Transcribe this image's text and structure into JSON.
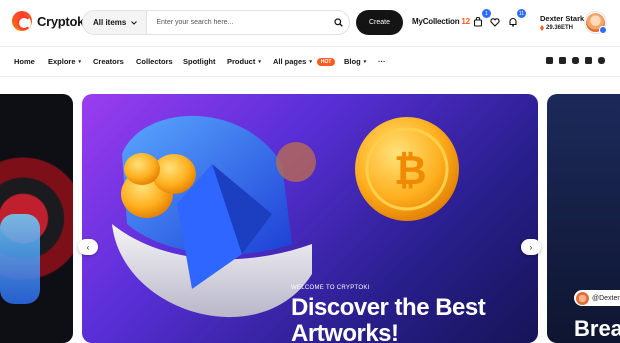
{
  "header": {
    "logo_text": "Cryptoki",
    "search_category": "All items",
    "search_placeholder": "Enter your search here...",
    "create_label": "Create",
    "collection_label": "MyCollection",
    "collection_count": "12",
    "cart_badge": "1",
    "notif_badge": "11",
    "user_name": "Dexter Stark",
    "user_balance": "29.36ETH"
  },
  "nav": {
    "items": [
      {
        "label": "Home"
      },
      {
        "label": "Explore"
      },
      {
        "label": "Creators"
      },
      {
        "label": "Collectors"
      },
      {
        "label": "Spotlight"
      },
      {
        "label": "Product"
      },
      {
        "label": "All pages"
      },
      {
        "label": "Blog"
      },
      {
        "label": "···"
      }
    ],
    "hot_label": "HOT",
    "socials": [
      "facebook-icon",
      "twitter-icon",
      "instagram-icon",
      "twitch-icon",
      "discord-icon"
    ]
  },
  "hero": {
    "kicker": "WELCOME TO CRYPTOKI",
    "title": "Discover the Best Artworks!",
    "right_tag": "@Dexter",
    "right_title": "Brea"
  },
  "colors": {
    "accent": "#ff5a1f",
    "badge": "#2e6bff",
    "hero_start": "#9b3df0",
    "hero_end": "#161456"
  }
}
